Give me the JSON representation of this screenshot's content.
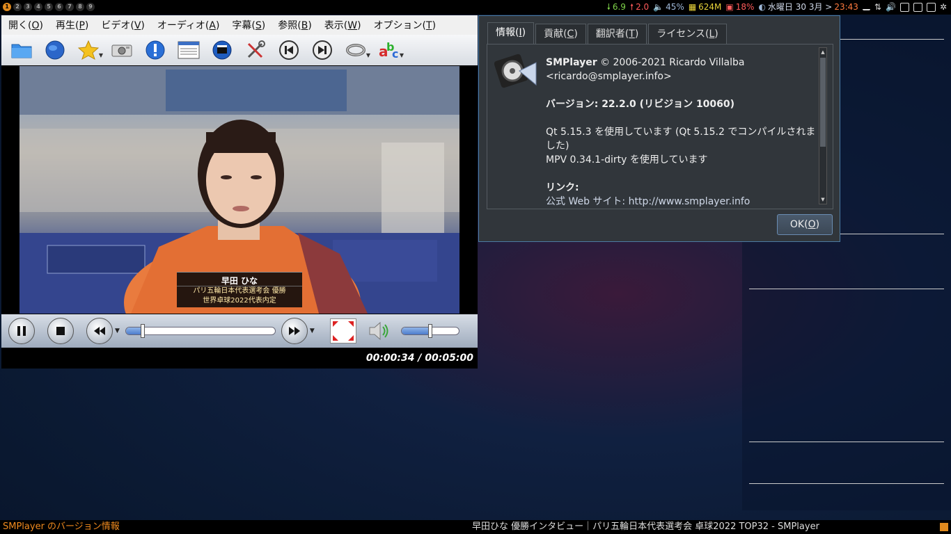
{
  "topbar": {
    "workspaces": [
      "1",
      "2",
      "3",
      "4",
      "5",
      "6",
      "7",
      "8",
      "9"
    ],
    "active_workspace": "1",
    "cpu": "6.9",
    "load": "2.0",
    "volume": "45%",
    "memory": "624M",
    "disk": "18%",
    "clock_date": "水曜日 30 3月 >",
    "clock_time": "23:43",
    "colors": {
      "cpu": "#7fd34a",
      "load": "#ff5b5b",
      "mem": "#e8d33a",
      "disk": "#ff5b5b",
      "time": "#ff7a3d"
    }
  },
  "player": {
    "menu": [
      {
        "label": "開く(",
        "key": "O",
        "end": ")"
      },
      {
        "label": "再生(",
        "key": "P",
        "end": ")"
      },
      {
        "label": "ビデオ(",
        "key": "V",
        "end": ")"
      },
      {
        "label": "オーディオ(",
        "key": "A",
        "end": ")"
      },
      {
        "label": "字幕(",
        "key": "S",
        "end": ")"
      },
      {
        "label": "参照(",
        "key": "B",
        "end": ")"
      },
      {
        "label": "表示(",
        "key": "W",
        "end": ")"
      },
      {
        "label": "オプション(",
        "key": "T",
        "end": ")"
      }
    ],
    "toolbar_icons": [
      "folder-icon",
      "globe-icon",
      "favorites-icon",
      "screenshot-icon",
      "info-icon",
      "playlist-icon",
      "video-settings-icon",
      "preferences-icon",
      "previous-icon",
      "next-icon",
      "audio-track-icon",
      "subtitles-icon"
    ],
    "caption": {
      "name": "早田 ひな",
      "line1": "パリ五輪日本代表選考会 優勝",
      "line2": "世界卓球2022代表内定"
    },
    "progress_fraction": 0.113,
    "volume_fraction": 0.5,
    "time": "00:00:34 / 00:05:00"
  },
  "dialog": {
    "tabs": [
      {
        "label": "情報(",
        "key": "I",
        "end": ")"
      },
      {
        "label": "貢献(",
        "key": "C",
        "end": ")"
      },
      {
        "label": "翻訳者(",
        "key": "T",
        "end": ")"
      },
      {
        "label": "ライセンス(",
        "key": "L",
        "end": ")"
      }
    ],
    "app_name": "SMPlayer",
    "copyright": " © 2006-2021 Ricardo Villalba",
    "email": "<ricardo@smplayer.info>",
    "version": "バージョン: 22.2.0 (リビジョン 10060)",
    "qt_line": "Qt 5.15.3 を使用しています (Qt 5.15.2 でコンパイルされました)",
    "mpv_line": "MPV 0.34.1-dirty を使用しています",
    "links_heading": "リンク:",
    "website_partial": "公式 Web サイト: http://www.smplayer.info",
    "ok_label": "OK(",
    "ok_key": "O",
    "ok_end": ")"
  },
  "taskbar": {
    "left": "SMPlayer のバージョン情報",
    "right": "早田ひな 優勝インタビュー｜パリ五輪日本代表選考会 卓球2022 TOP32 - SMPlayer"
  }
}
